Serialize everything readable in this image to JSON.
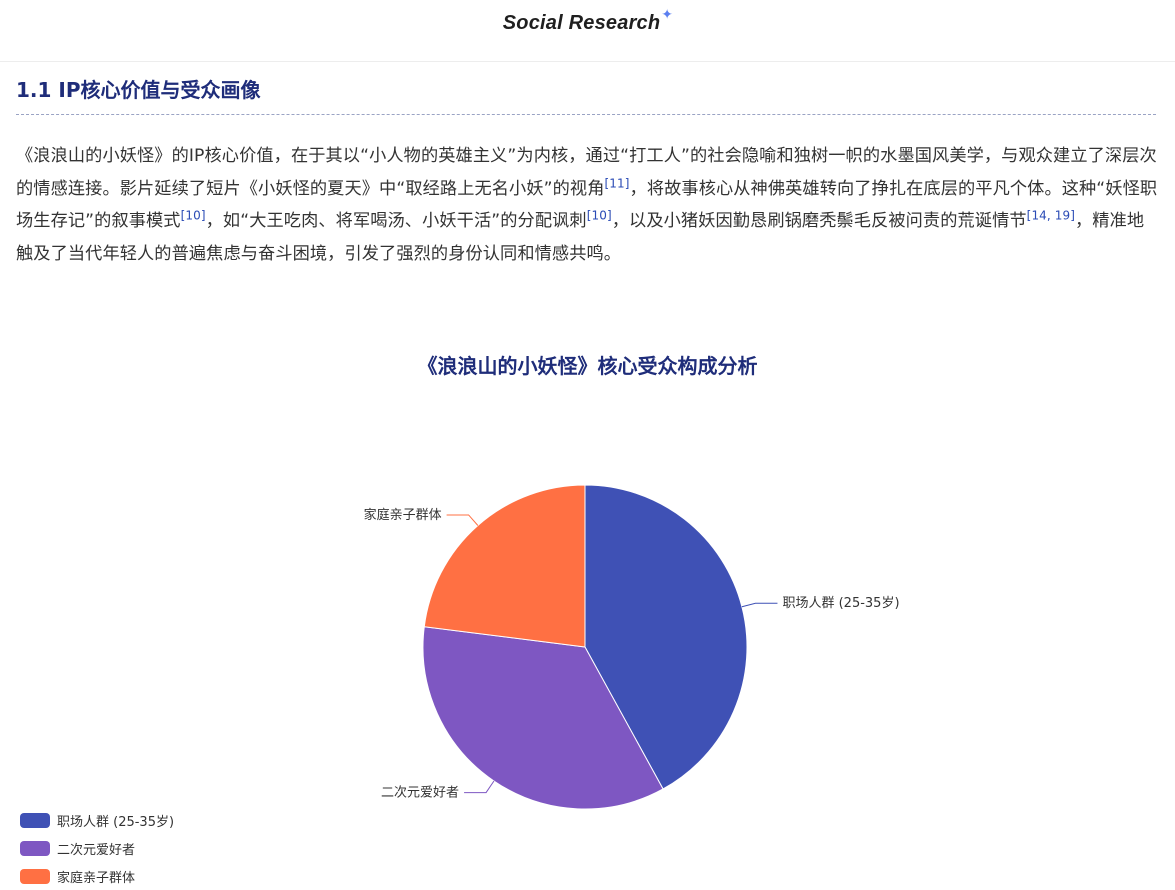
{
  "header": {
    "brand": "Social Research",
    "brand_sparkle": "✦"
  },
  "section": {
    "title": "1.1 IP核心价值与受众画像",
    "paragraph": [
      {
        "text": "《浪浪山的小妖怪》的IP核心价值，在于其以“小人物的英雄主义”为内核，通过“打工人”的社会隐喻和独树一帜的水墨国风美学，与观众建立了深层次的情感连接。影片延续了短片《小妖怪的夏天》中“取经路上无名小妖”的视角"
      },
      {
        "cite": "[11]"
      },
      {
        "text": "，将故事核心从神佛英雄转向了挣扎在底层的平凡个体。这种“妖怪职场生存记”的叙事模式"
      },
      {
        "cite": "[10]"
      },
      {
        "text": "，如“大王吃肉、将军喝汤、小妖干活”的分配讽刺"
      },
      {
        "cite": "[10]"
      },
      {
        "text": "，以及小猪妖因勤恳刷锅磨秃鬃毛反被问责的荒诞情节"
      },
      {
        "cite": "[14, 19]"
      },
      {
        "text": "，精准地触及了当代年轻人的普遍焦虑与奋斗困境，引发了强烈的身份认同和情感共鸣。"
      }
    ]
  },
  "chart_data": {
    "type": "pie",
    "title": "《浪浪山的小妖怪》核心受众构成分析",
    "categories": [
      "职场人群 (25-35岁)",
      "二次元爱好者",
      "家庭亲子群体"
    ],
    "values": [
      42,
      35,
      23
    ],
    "colors": [
      "#3f51b5",
      "#7e57c2",
      "#ff7043"
    ],
    "legend_position": "bottom-left",
    "start_angle_deg": 0,
    "direction": "clockwise"
  }
}
